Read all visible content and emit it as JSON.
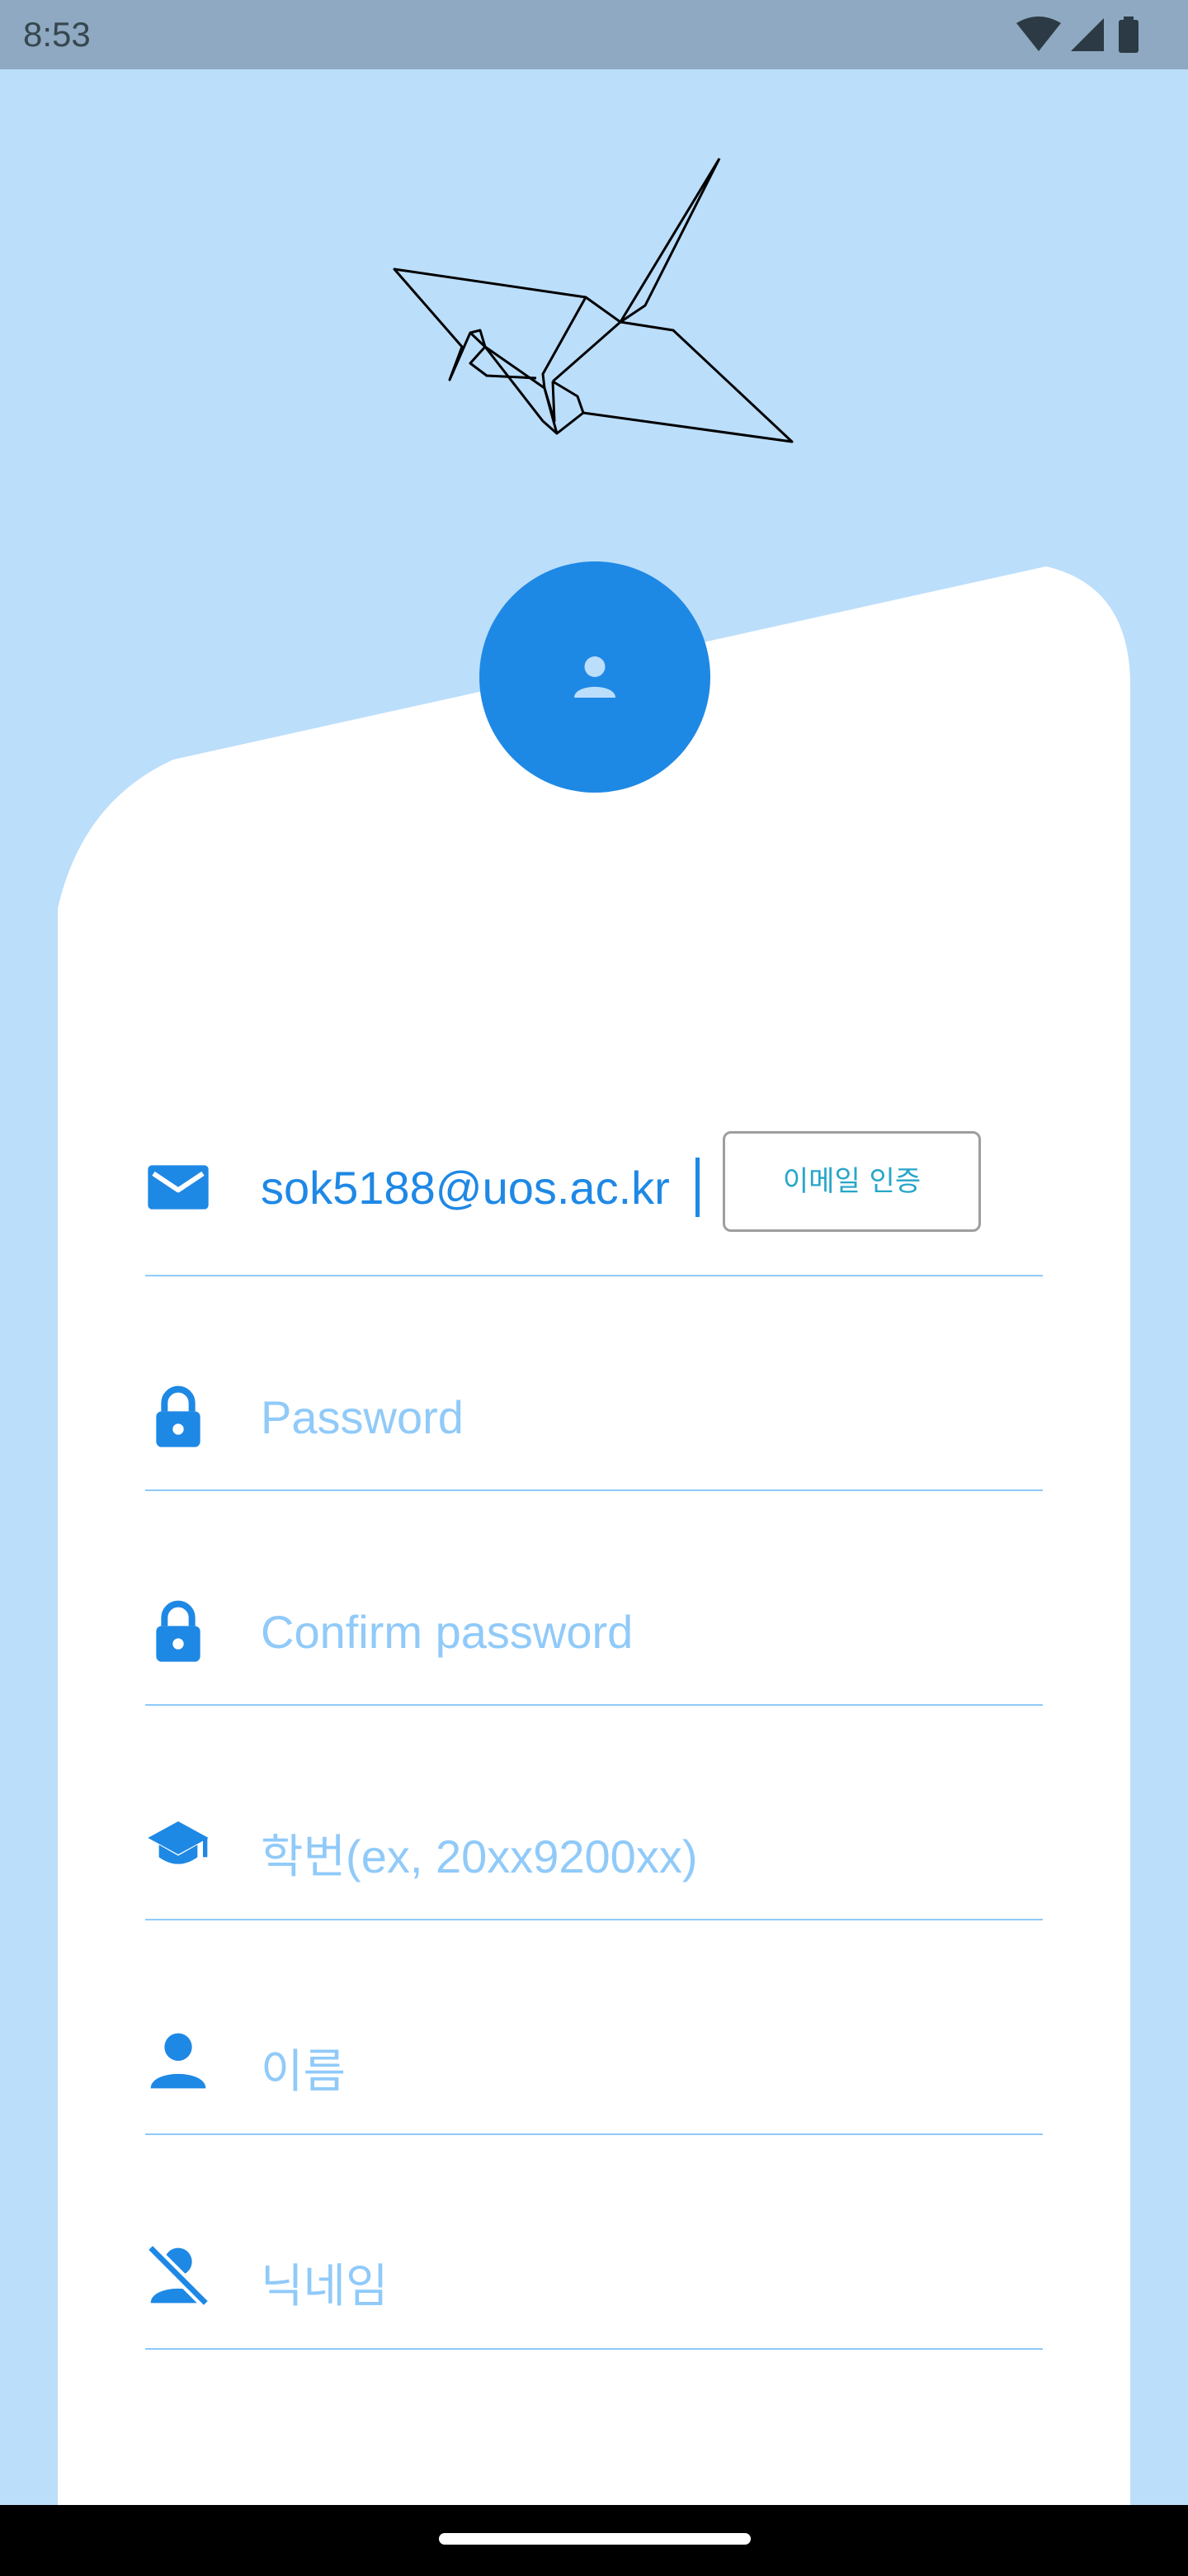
{
  "status_bar": {
    "time": "8:53",
    "icons": [
      "wifi-icon",
      "cellular-signal-icon",
      "battery-icon"
    ]
  },
  "header": {
    "illustration": "paper-crane-icon"
  },
  "avatar": {
    "icon": "person-icon"
  },
  "form": {
    "email": {
      "icon": "mail-icon",
      "value": "sok5188@uos.ac.kr",
      "verify_button_label": "이메일 인증"
    },
    "password": {
      "icon": "lock-icon",
      "placeholder": "Password"
    },
    "confirm_password": {
      "icon": "lock-icon",
      "placeholder": "Confirm password"
    },
    "student_id": {
      "icon": "graduation-cap-icon",
      "placeholder": "학번(ex, 20xx9200xx)"
    },
    "name": {
      "icon": "person-icon",
      "placeholder": "이름"
    },
    "nickname": {
      "icon": "person-off-icon",
      "placeholder": "닉네임"
    }
  },
  "colors": {
    "background": "#BBDEFB",
    "accent": "#1E88E5",
    "placeholder": "#90CAF9",
    "divider": "#90CAF9",
    "verify_text": "#26A6C9",
    "status_bar": "#8EA9C1"
  }
}
